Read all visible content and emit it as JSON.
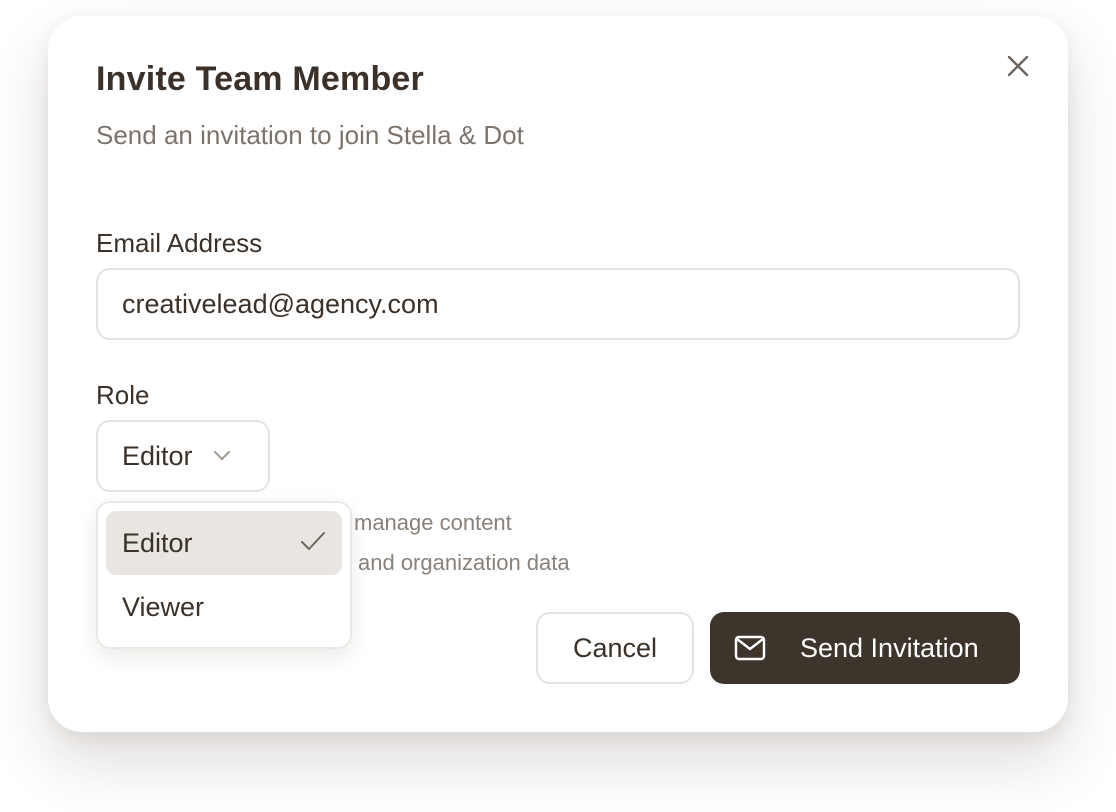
{
  "dialog": {
    "title": "Invite Team Member",
    "subtitle": "Send an invitation to join Stella & Dot",
    "close_icon": "close-icon"
  },
  "email": {
    "label": "Email Address",
    "value": "creativelead@agency.com"
  },
  "role": {
    "label": "Role",
    "selected": "Editor",
    "options": [
      {
        "label": "Editor",
        "selected": true
      },
      {
        "label": "Viewer",
        "selected": false
      }
    ],
    "hints": [
      "manage content",
      "and organization data"
    ]
  },
  "actions": {
    "cancel_label": "Cancel",
    "send_label": "Send Invitation",
    "send_icon": "mail-icon"
  },
  "colors": {
    "primary": "#3d342b",
    "text": "#3b3129",
    "muted": "#7c746c",
    "border": "#e6e2de",
    "selected_bg": "#e9e6e2"
  }
}
